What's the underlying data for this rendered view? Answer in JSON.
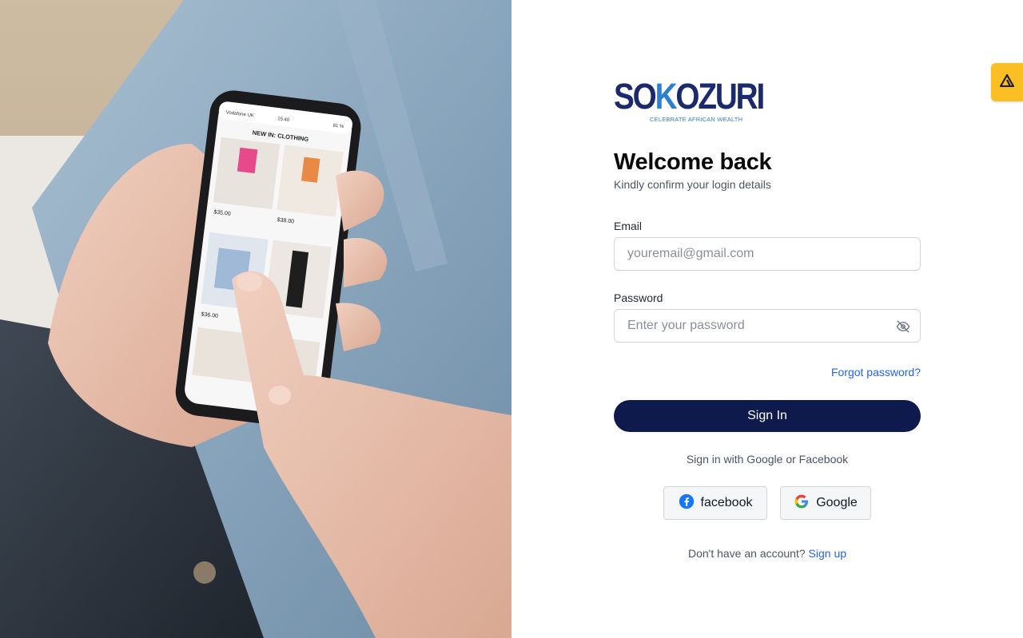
{
  "brand": {
    "name_left": "SO",
    "name_accent": "K",
    "name_right": "OZURI",
    "tagline": "CELEBRATE AFRICAN WEALTH",
    "primary_color": "#0e1a4b",
    "accent_color": "#2f7fd0",
    "link_color": "#2563eb"
  },
  "hero_image": {
    "phone": {
      "carrier": "Vodafone UK",
      "time": "15:40",
      "battery": "81 %",
      "header": "NEW IN: CLOTHING",
      "prices": [
        "$35.00",
        "$38.00",
        "$36.00"
      ]
    }
  },
  "login": {
    "title": "Welcome back",
    "subtitle": "Kindly confirm your login details",
    "email_label": "Email",
    "email_placeholder": "youremail@gmail.com",
    "email_value": "",
    "password_label": "Password",
    "password_placeholder": "Enter your password",
    "password_value": "",
    "password_visibility_icon": "eye-off-icon",
    "forgot_label": "Forgot password?",
    "signin_label": "Sign In",
    "social_prompt": "Sign in with Google or Facebook",
    "facebook_label": "facebook",
    "google_label": "Google",
    "no_account_text": "Don't have an account?",
    "signup_label": "Sign up"
  },
  "extension_badge": {
    "icon": "extension-logo-icon",
    "color": "#fbbf24"
  }
}
